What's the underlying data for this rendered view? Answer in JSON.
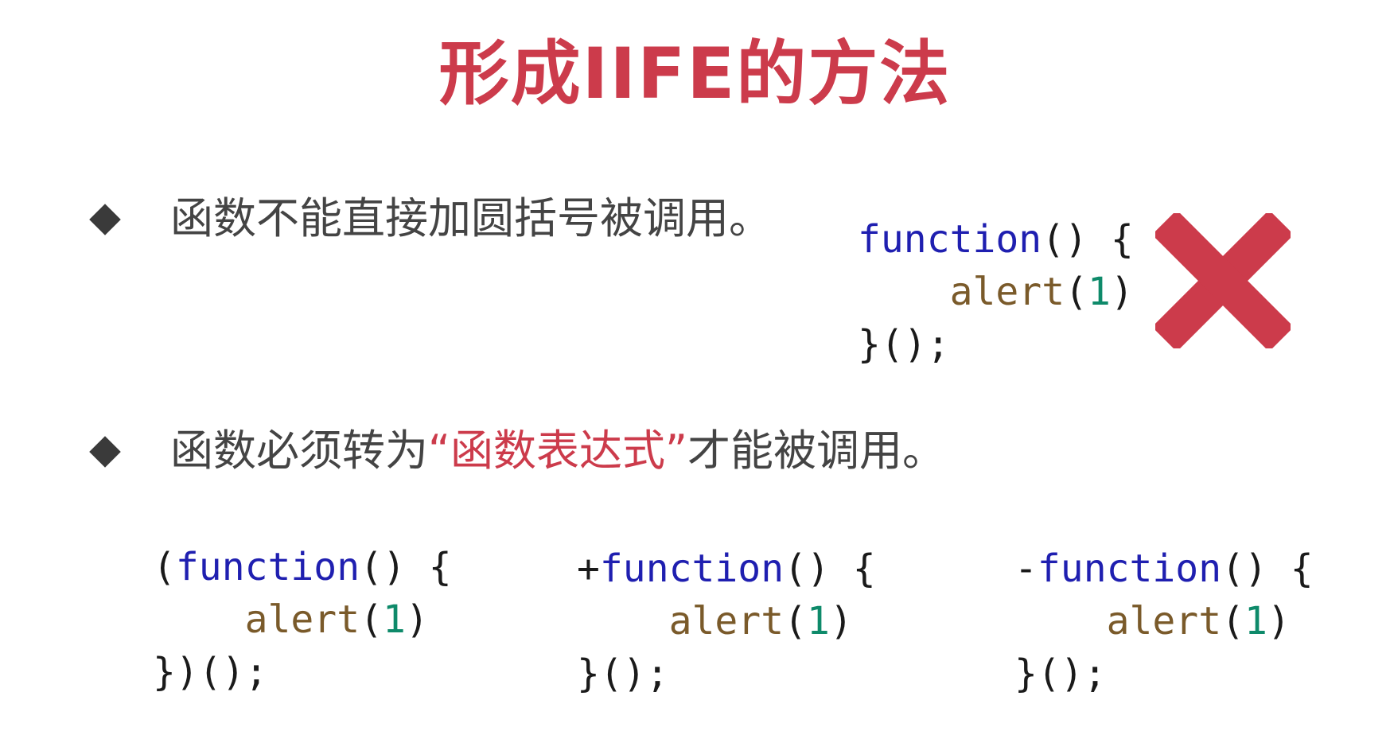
{
  "title": "形成IIFE的方法",
  "bullets": [
    {
      "text": "函数不能直接加圆括号被调用。"
    },
    {
      "before": "函数必须转为",
      "highlight": "“函数表达式”",
      "after": "才能被调用。"
    }
  ],
  "code_wrong": {
    "line1_kw": "function",
    "line1_rest": "() {",
    "line2_fn": "alert",
    "line2_open": "(",
    "line2_num": "1",
    "line2_close": ")",
    "line3": "}();"
  },
  "code_examples": [
    {
      "prefix": "(",
      "kw": "function",
      "rest": "() {",
      "fn": "alert",
      "open": "(",
      "num": "1",
      "close": ")",
      "end": "})();"
    },
    {
      "prefix": "+",
      "kw": "function",
      "rest": "() {",
      "fn": "alert",
      "open": "(",
      "num": "1",
      "close": ")",
      "end": "}();"
    },
    {
      "prefix": "-",
      "kw": "function",
      "rest": "() {",
      "fn": "alert",
      "open": "(",
      "num": "1",
      "close": ")",
      "end": "}();"
    }
  ],
  "icons": {
    "wrong": "cross-icon",
    "bullet": "diamond-bullet-icon"
  },
  "colors": {
    "accent": "#cc3b4b",
    "keyword": "#1f1fb0",
    "function_name": "#7a5a2a",
    "number": "#0e8a6a",
    "text": "#444444"
  }
}
